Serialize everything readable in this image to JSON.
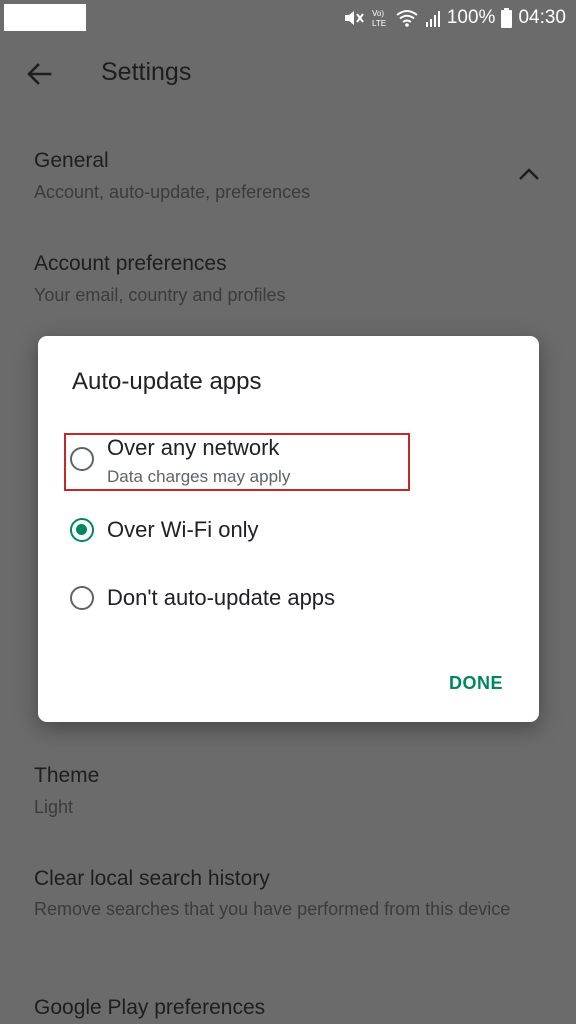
{
  "status_bar": {
    "battery": "100%",
    "time": "04:30",
    "icons": [
      "mute-icon",
      "volte-icon",
      "wifi-icon",
      "signal-icon",
      "battery-icon"
    ]
  },
  "app_bar": {
    "title": "Settings",
    "back_icon": "arrow-back-icon"
  },
  "settings": {
    "general": {
      "title": "General",
      "subtitle": "Account, auto-update, preferences"
    },
    "account_preferences": {
      "title": "Account preferences",
      "subtitle": "Your email, country and profiles"
    },
    "theme": {
      "title": "Theme",
      "subtitle": "Light"
    },
    "clear_history": {
      "title": "Clear local search history",
      "subtitle": "Remove searches that you have performed from this device"
    },
    "google_play_preferences": {
      "title": "Google Play preferences"
    }
  },
  "dialog": {
    "title": "Auto-update apps",
    "options": [
      {
        "label": "Over any network",
        "sublabel": "Data charges may apply",
        "selected": false
      },
      {
        "label": "Over Wi-Fi only",
        "selected": true
      },
      {
        "label": "Don't auto-update apps",
        "selected": false
      }
    ],
    "done_label": "DONE"
  },
  "colors": {
    "accent": "#01875f",
    "highlight_box": "#c62828",
    "scrim_background": "#6b6b6b"
  }
}
